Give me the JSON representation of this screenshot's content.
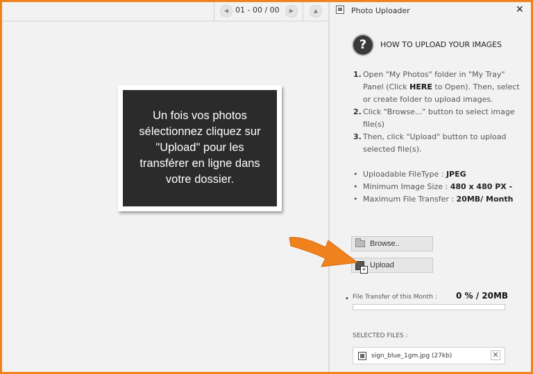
{
  "topbar": {
    "pager_text": "01 - 00 / 00",
    "prev_icon": "chevron-left-icon",
    "next_icon": "chevron-right-icon",
    "collapse_icon": "caret-up-icon"
  },
  "callout": {
    "lines": [
      "Un fois vos photos",
      "sélectionnez cliquez sur",
      "\"Upload\" pour les",
      "transférer en ligne dans",
      "votre dossier."
    ]
  },
  "panel": {
    "title": "Photo Uploader",
    "close_label": "✕",
    "help_glyph": "?",
    "help_title": "HOW TO UPLOAD YOUR IMAGES",
    "steps": [
      {
        "num": "1.",
        "pre": "Open \"My Photos\" folder in \"My Tray\" Panel (Click ",
        "bold": "HERE",
        "post": " to Open). Then, select or create folder to upload images."
      },
      {
        "num": "2.",
        "pre": "Click \"Browse...\" button to select image file(s)",
        "bold": "",
        "post": ""
      },
      {
        "num": "3.",
        "pre": "Then, click \"Upload\" button to upload selected file(s).",
        "bold": "",
        "post": ""
      }
    ],
    "requirements": [
      {
        "label": "Uploadable FileType : ",
        "value": "JPEG"
      },
      {
        "label": "Minimum Image Size : ",
        "value": "480 x 480 PX -"
      },
      {
        "label": "Maximum File Transfer : ",
        "value": "20MB/ Month"
      }
    ],
    "browse_label": "Browse..",
    "upload_label": "Upload",
    "transfer_bullet": "•",
    "transfer_label": "File Transfer of this Month :",
    "transfer_value": "0 % / 20MB",
    "transfer_percent": 0,
    "selected_files_label": "SELECTED FILES :",
    "files": [
      {
        "name": "sign_blue_1gm.jpg (27kb)",
        "remove_label": "✕"
      }
    ]
  },
  "colors": {
    "frame_border": "#f0821e",
    "arrow": "#f0821e",
    "callout_bg": "#2b2b2b"
  }
}
